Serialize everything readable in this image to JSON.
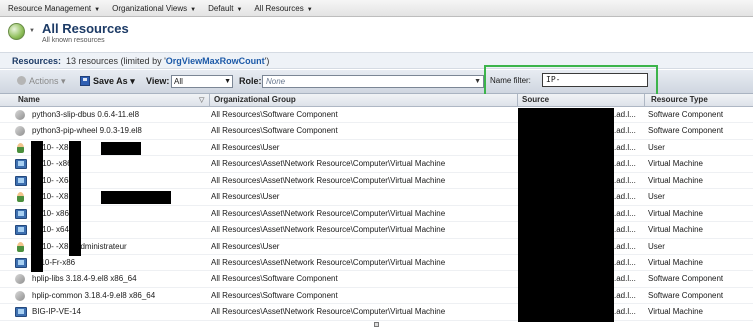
{
  "menu": {
    "items": [
      {
        "label": "Resource Management"
      },
      {
        "label": "Organizational Views"
      },
      {
        "label": "Default"
      },
      {
        "label": "All Resources"
      }
    ]
  },
  "header": {
    "title": "All Resources",
    "subtitle": "All known resources",
    "icon": "globe-icon"
  },
  "summary": {
    "label": "Resources:",
    "count_text": "13 resources (limited by '",
    "link_text": "OrgViewMaxRowCount",
    "suffix": "')"
  },
  "toolbar": {
    "actions_label": "Actions",
    "save_as_label": "Save As",
    "view_label": "View:",
    "view_value": "All",
    "role_label": "Role:",
    "role_value": "None",
    "name_filter_label": "Name filter:",
    "name_filter_value": "IP-",
    "highlight_color": "#3cb44b"
  },
  "table": {
    "columns": [
      "Name",
      "Organizational Group",
      "Source",
      "Resource Type"
    ],
    "rows": [
      {
        "icon": "component-icon",
        "name": "python3-slip-dbus 0.6.4-11.el8",
        "group": "All Resources\\Software Component",
        "source": ".ad.l...",
        "type": "Software Component"
      },
      {
        "icon": "component-icon",
        "name": "python3-pip-wheel 9.0.3-19.el8",
        "group": "All Resources\\Software Component",
        "source": ".ad.l...",
        "type": "Software Component"
      },
      {
        "icon": "user-icon",
        "name": "-W10-  -X86\\",
        "group": "All Resources\\User",
        "source": ".ad.l...",
        "type": "User"
      },
      {
        "icon": "vm-icon",
        "name": "-W10-  -x86",
        "group": "All Resources\\Asset\\Network Resource\\Computer\\Virtual Machine",
        "source": ".ad.l...",
        "type": "Virtual Machine"
      },
      {
        "icon": "vm-icon",
        "name": "-W10-  -X64",
        "group": "All Resources\\Asset\\Network Resource\\Computer\\Virtual Machine",
        "source": ".ad.l...",
        "type": "Virtual Machine"
      },
      {
        "icon": "user-icon",
        "name": "-W10-  -X86\\",
        "group": "All Resources\\User",
        "source": ".ad.l...",
        "type": "User"
      },
      {
        "icon": "vm-icon",
        "name": "-W10-  x86",
        "group": "All Resources\\Asset\\Network Resource\\Computer\\Virtual Machine",
        "source": ".ad.l...",
        "type": "Virtual Machine"
      },
      {
        "icon": "vm-icon",
        "name": "-W10-  x64",
        "group": "All Resources\\Asset\\Network Resource\\Computer\\Virtual Machine",
        "source": ".ad.l...",
        "type": "Virtual Machine"
      },
      {
        "icon": "user-icon",
        "name": "-W10-  -X86\\Administrateur",
        "group": "All Resources\\User",
        "source": ".ad.l...",
        "type": "User"
      },
      {
        "icon": "vm-icon",
        "name": "-w10-Fr-x86",
        "group": "All Resources\\Asset\\Network Resource\\Computer\\Virtual Machine",
        "source": ".ad.l...",
        "type": "Virtual Machine"
      },
      {
        "icon": "component-icon",
        "name": "hplip-libs 3.18.4-9.el8 x86_64",
        "group": "All Resources\\Software Component",
        "source": ".ad.l...",
        "type": "Software Component"
      },
      {
        "icon": "component-icon",
        "name": "hplip-common 3.18.4-9.el8 x86_64",
        "group": "All Resources\\Software Component",
        "source": ".ad.l...",
        "type": "Software Component"
      },
      {
        "icon": "vm-icon",
        "name": "BIG-IP-VE-14",
        "group": "All Resources\\Asset\\Network Resource\\Computer\\Virtual Machine",
        "source": ".ad.l...",
        "type": "Virtual Machine"
      }
    ]
  }
}
